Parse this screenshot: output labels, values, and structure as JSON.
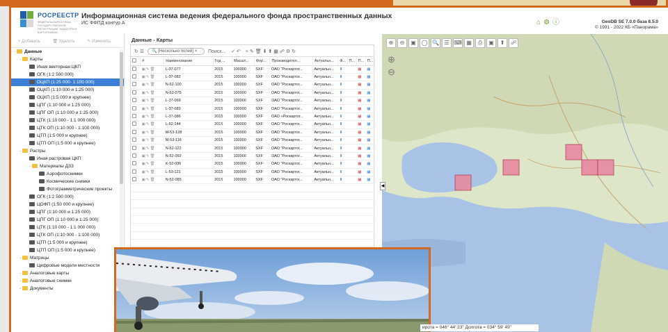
{
  "header": {
    "logo_text": "РОСРЕЕСТР",
    "logo_sub": "ФЕДЕРАЛЬНАЯ СЛУЖБА ГОСУДАРСТВЕННОЙ РЕГИСТРАЦИИ, КАДАСТРА И КАРТОГРАФИИ",
    "title": "Информационная система ведения федерального фонда пространственных данных",
    "subtitle": "ИС ФФПД контур А",
    "version_line1": "GeoDB SE 7.0.0 база 8.5.0",
    "version_line2": "© 1991 - 2022 КБ «Панорама»"
  },
  "left": {
    "toolbar": {
      "add": "Добавить",
      "delete": "Удалить",
      "edit": "Изменить"
    },
    "tree": [
      {
        "label": "Данные",
        "level": 0,
        "type": "folder",
        "bold": true
      },
      {
        "label": "Карты",
        "level": 1,
        "type": "folder"
      },
      {
        "label": "Иная векторная ЦКП",
        "level": 2,
        "type": "layer"
      },
      {
        "label": "ОГК (1:2 500 000)",
        "level": 2,
        "type": "layer"
      },
      {
        "label": "ОЦКП (1:25 000- 1:100 000)",
        "level": 2,
        "type": "layer",
        "selected": true
      },
      {
        "label": "ОЦКП (1:10 000 и 1:25 000)",
        "level": 2,
        "type": "layer"
      },
      {
        "label": "ОЦКП (1:5 000 и крупнее)",
        "level": 2,
        "type": "layer"
      },
      {
        "label": "ЦПГ (1:10 000 и 1:25 000)",
        "level": 2,
        "type": "layer"
      },
      {
        "label": "ЦПГ ОП (1:10 000 и 1:25 000)",
        "level": 2,
        "type": "layer"
      },
      {
        "label": "ЦТК (1:10 000 - 1:1 000 000)",
        "level": 2,
        "type": "layer"
      },
      {
        "label": "ЦТК ОП (1:10 000 - 1:100 000)",
        "level": 2,
        "type": "layer"
      },
      {
        "label": "ЦТП (1:5 000 и крупнее)",
        "level": 2,
        "type": "layer"
      },
      {
        "label": "ЦТП ОП (1:5 000 и крупнее)",
        "level": 2,
        "type": "layer"
      },
      {
        "label": "Растры",
        "level": 1,
        "type": "folder"
      },
      {
        "label": "Иная растровая ЦКП",
        "level": 2,
        "type": "layer"
      },
      {
        "label": "Материалы ДЗЗ",
        "level": 2,
        "type": "folder"
      },
      {
        "label": "Аэрофотоснимки",
        "level": 3,
        "type": "layer"
      },
      {
        "label": "Космические снимки",
        "level": 3,
        "type": "layer"
      },
      {
        "label": "Фотограмметрические проекты",
        "level": 3,
        "type": "layer"
      },
      {
        "label": "ОГК (1:2 500 000)",
        "level": 2,
        "type": "layer"
      },
      {
        "label": "ЦОФП (1:50 000 и крупнее)",
        "level": 2,
        "type": "layer"
      },
      {
        "label": "ЦПГ (1:10 000 и 1:25 000)",
        "level": 2,
        "type": "layer"
      },
      {
        "label": "ЦПГ ОП (1:10 000 и 1:25 000)",
        "level": 2,
        "type": "layer"
      },
      {
        "label": "ЦТК (1:10 000 - 1:1 000 000)",
        "level": 2,
        "type": "layer"
      },
      {
        "label": "ЦТК ОП (1:10 000 - 1:100 000)",
        "level": 2,
        "type": "layer"
      },
      {
        "label": "ЦТП (1:5 000 и крупнее)",
        "level": 2,
        "type": "layer"
      },
      {
        "label": "ЦТП ОП (1:5 000 и крупнее)",
        "level": 2,
        "type": "layer"
      },
      {
        "label": "Матрицы",
        "level": 1,
        "type": "folder"
      },
      {
        "label": "Цифровые модели местности",
        "level": 2,
        "type": "layer"
      },
      {
        "label": "Аналоговые карты",
        "level": 1,
        "type": "folder"
      },
      {
        "label": "Аналоговые снимки",
        "level": 1,
        "type": "folder"
      },
      {
        "label": "Документы",
        "level": 1,
        "type": "folder"
      }
    ]
  },
  "grid": {
    "title": "Данные - Карты",
    "search_placeholder": "[Несколько полей]",
    "search_button": "Поиск...",
    "columns": [
      "Наименование",
      "Год ...",
      "Масшт...",
      "Фор...",
      "Производител...",
      "Актуальн...",
      "Ф...",
      "П...",
      "П...",
      "П..."
    ],
    "rows": [
      [
        "L-37-077",
        "2015",
        "100000",
        "SXF",
        "ОАО \"Роскартог...",
        "Актуальн..."
      ],
      [
        "L-37-082",
        "2015",
        "100000",
        "SXF",
        "ОАО \"Роскартог...",
        "Актуальн..."
      ],
      [
        "N-52-100",
        "2015",
        "100000",
        "SXF",
        "ОАО \"Роскартог...",
        "Актуальн..."
      ],
      [
        "N-52-075",
        "2015",
        "100000",
        "SXF",
        "ОАО \"Роскартог...",
        "Актуальн..."
      ],
      [
        "L-37-069",
        "2015",
        "100000",
        "SXF",
        "ОАО \"Роскартог...",
        "Актуальн..."
      ],
      [
        "L-37-083",
        "2015",
        "100000",
        "SXF",
        "ОАО \"Роскартог...",
        "Актуальн..."
      ],
      [
        "L-37-086",
        "2015",
        "100000",
        "SXF",
        "ОАО «Роскартог...",
        "Актуальн..."
      ],
      [
        "L-52-144",
        "2015",
        "100000",
        "SXF",
        "ОАО \"Роскартог...",
        "Актуальн..."
      ],
      [
        "M-53-128",
        "2015",
        "100000",
        "SXF",
        "ОАО \"Роскартог...",
        "Актуальн..."
      ],
      [
        "M-53-116",
        "2015",
        "100000",
        "SXF",
        "ОАО \"Роскартог...",
        "Актуальн..."
      ],
      [
        "N-52-122",
        "2015",
        "100000",
        "SXF",
        "ОАО \"Роскартог...",
        "Актуальн..."
      ],
      [
        "N-52-092",
        "2015",
        "100000",
        "SXF",
        "ОАО \"Роскартог...",
        "Актуальн..."
      ],
      [
        "K-52-036",
        "2015",
        "100000",
        "SXF",
        "ОАО \"Роскартог...",
        "Актуальн..."
      ],
      [
        "L-53-121",
        "2015",
        "100000",
        "SXF",
        "ОАО \"Роскартог...",
        "Актуальн..."
      ],
      [
        "N-52-085",
        "2015",
        "100000",
        "SXF",
        "ОАО \"Роскартог...",
        "Актуальн..."
      ]
    ]
  },
  "map": {
    "coords": "ирота = 046° 44' 23\"  Долгота = 034° 59' 49\""
  }
}
